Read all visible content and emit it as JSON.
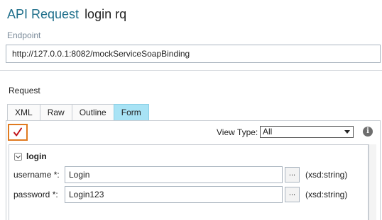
{
  "header": {
    "app_title": "API Request",
    "request_name": "login rq"
  },
  "endpoint": {
    "label": "Endpoint",
    "value": "http://127.0.0.1:8082/mockServiceSoapBinding"
  },
  "request": {
    "label": "Request",
    "tabs": [
      {
        "label": "XML",
        "active": false
      },
      {
        "label": "Raw",
        "active": false
      },
      {
        "label": "Outline",
        "active": false
      },
      {
        "label": "Form",
        "active": true
      }
    ]
  },
  "toolbar": {
    "validate_icon": "checkmark-icon",
    "view_type_label": "View Type:",
    "view_type_value": "All",
    "info_icon": "info-icon",
    "info_glyph": "i"
  },
  "form": {
    "section_title": "login",
    "fields": [
      {
        "label": "username *:",
        "value": "Login",
        "button": "...",
        "type": "(xsd:string)"
      },
      {
        "label": "password *:",
        "value": "Login123",
        "button": "...",
        "type": "(xsd:string)"
      }
    ]
  },
  "colors": {
    "accent_title": "#1f6f8b",
    "active_tab": "#a8e3f5",
    "highlight_border": "#e07a20",
    "check_mark": "#c0141b"
  }
}
